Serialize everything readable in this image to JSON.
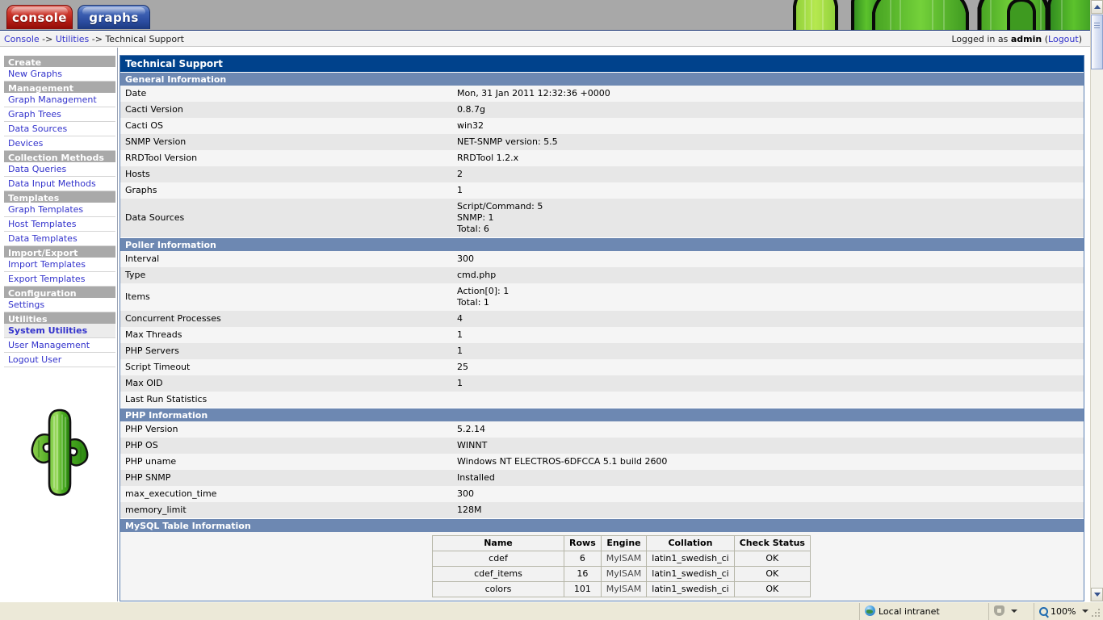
{
  "header": {
    "tabs": [
      {
        "label": "console",
        "active": true
      },
      {
        "label": "graphs",
        "active": false
      }
    ],
    "breadcrumb": {
      "console": "Console",
      "sep1": " -> ",
      "utilities": "Utilities",
      "sep2": " -> ",
      "current": "Technical Support"
    },
    "login": {
      "prefix": "Logged in as ",
      "user": "admin",
      "logout_open": " (",
      "logout": "Logout",
      "logout_close": ")"
    },
    "banner_color": "#a8a8a8",
    "banner_rule_color": "#213a77"
  },
  "sidebar": {
    "groups": [
      {
        "header": "Create",
        "items": [
          {
            "label": "New Graphs",
            "active": false
          }
        ]
      },
      {
        "header": "Management",
        "items": [
          {
            "label": "Graph Management",
            "active": false
          },
          {
            "label": "Graph Trees",
            "active": false
          },
          {
            "label": "Data Sources",
            "active": false
          },
          {
            "label": "Devices",
            "active": false
          }
        ]
      },
      {
        "header": "Collection Methods",
        "items": [
          {
            "label": "Data Queries",
            "active": false
          },
          {
            "label": "Data Input Methods",
            "active": false
          }
        ]
      },
      {
        "header": "Templates",
        "items": [
          {
            "label": "Graph Templates",
            "active": false
          },
          {
            "label": "Host Templates",
            "active": false
          },
          {
            "label": "Data Templates",
            "active": false
          }
        ]
      },
      {
        "header": "Import/Export",
        "items": [
          {
            "label": "Import Templates",
            "active": false
          },
          {
            "label": "Export Templates",
            "active": false
          }
        ]
      },
      {
        "header": "Configuration",
        "items": [
          {
            "label": "Settings",
            "active": false
          }
        ]
      },
      {
        "header": "Utilities",
        "items": [
          {
            "label": "System Utilities",
            "active": true
          },
          {
            "label": "User Management",
            "active": false
          },
          {
            "label": "Logout User",
            "active": false
          }
        ]
      }
    ],
    "logo_icon": "cactus-icon"
  },
  "main": {
    "title": "Technical Support",
    "title_bg": "#00428c",
    "section_bg": "#6d88b2",
    "sections": [
      {
        "header": "General Information",
        "rows": [
          {
            "key": "Date",
            "value": "Mon, 31 Jan 2011 12:32:36 +0000"
          },
          {
            "key": "Cacti Version",
            "value": "0.8.7g"
          },
          {
            "key": "Cacti OS",
            "value": "win32"
          },
          {
            "key": "SNMP Version",
            "value": "NET-SNMP version: 5.5"
          },
          {
            "key": "RRDTool Version",
            "value": "RRDTool 1.2.x"
          },
          {
            "key": "Hosts",
            "value": "2"
          },
          {
            "key": "Graphs",
            "value": "1"
          },
          {
            "key": "Data Sources",
            "value": "Script/Command: 5\nSNMP: 1\nTotal: 6"
          }
        ]
      },
      {
        "header": "Poller Information",
        "rows": [
          {
            "key": "Interval",
            "value": "300"
          },
          {
            "key": "Type",
            "value": "cmd.php"
          },
          {
            "key": "Items",
            "value": "Action[0]: 1\nTotal: 1"
          },
          {
            "key": "Concurrent Processes",
            "value": "4"
          },
          {
            "key": "Max Threads",
            "value": "1"
          },
          {
            "key": "PHP Servers",
            "value": "1"
          },
          {
            "key": "Script Timeout",
            "value": "25"
          },
          {
            "key": "Max OID",
            "value": "1"
          },
          {
            "key": "Last Run Statistics",
            "value": ""
          }
        ]
      },
      {
        "header": "PHP Information",
        "rows": [
          {
            "key": "PHP Version",
            "value": "5.2.14"
          },
          {
            "key": "PHP OS",
            "value": "WINNT"
          },
          {
            "key": "PHP uname",
            "value": "Windows NT ELECTROS-6DFCCA 5.1 build 2600"
          },
          {
            "key": "PHP SNMP",
            "value": "Installed"
          },
          {
            "key": "max_execution_time",
            "value": "300"
          },
          {
            "key": "memory_limit",
            "value": "128M"
          }
        ]
      }
    ],
    "mysql_section": {
      "header": "MySQL Table Information",
      "columns": [
        "Name",
        "Rows",
        "Engine",
        "Collation",
        "Check Status"
      ],
      "rows": [
        {
          "name": "cdef",
          "rows": "6",
          "engine": "MyISAM",
          "collation": "latin1_swedish_ci",
          "status": "OK"
        },
        {
          "name": "cdef_items",
          "rows": "16",
          "engine": "MyISAM",
          "collation": "latin1_swedish_ci",
          "status": "OK"
        },
        {
          "name": "colors",
          "rows": "101",
          "engine": "MyISAM",
          "collation": "latin1_swedish_ci",
          "status": "OK"
        }
      ]
    }
  },
  "scrollbar": {
    "up_icon": "chevron-up-icon",
    "down_icon": "chevron-down-icon"
  },
  "statusbar": {
    "zone_icon": "globe-icon",
    "zone": "Local intranet",
    "security_icon": "shield-icon",
    "zoom_icon": "magnifier-icon",
    "zoom": "100%"
  }
}
